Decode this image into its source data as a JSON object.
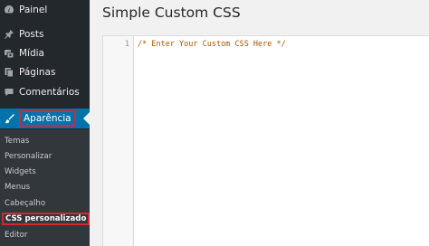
{
  "sidebar": {
    "items": [
      {
        "label": "Painel",
        "icon": "dashboard-icon"
      },
      {
        "label": "Posts",
        "icon": "pin-icon"
      },
      {
        "label": "Mídia",
        "icon": "media-icon"
      },
      {
        "label": "Páginas",
        "icon": "pages-icon"
      },
      {
        "label": "Comentários",
        "icon": "comments-icon"
      },
      {
        "label": "Aparência",
        "icon": "brush-icon",
        "active": true
      }
    ],
    "submenu": [
      {
        "label": "Temas"
      },
      {
        "label": "Personalizar"
      },
      {
        "label": "Widgets"
      },
      {
        "label": "Menus"
      },
      {
        "label": "Cabeçalho"
      },
      {
        "label": "CSS personalizado",
        "current": true
      },
      {
        "label": "Editor"
      }
    ]
  },
  "main": {
    "title": "Simple Custom CSS",
    "editor": {
      "lines": [
        {
          "number": "1",
          "code": "/* Enter Your Custom CSS Here */"
        }
      ]
    }
  },
  "colors": {
    "sidebar_bg": "#23282d",
    "submenu_bg": "#32373c",
    "active_bg": "#0073aa",
    "highlight_red": "#d6262f",
    "comment_color": "#aa5500"
  }
}
